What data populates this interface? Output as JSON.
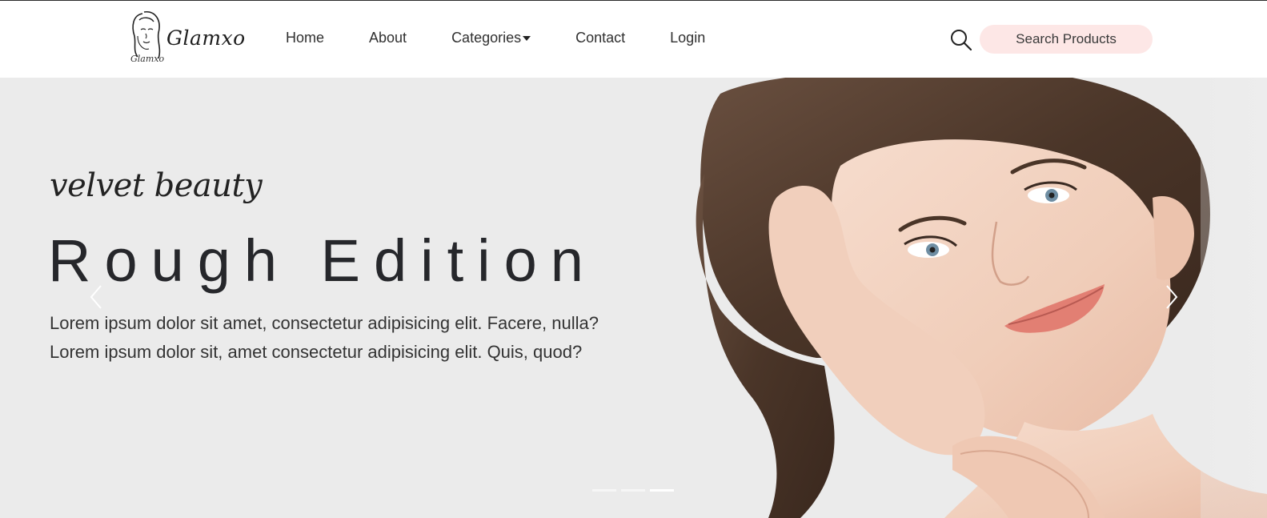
{
  "brand": {
    "name": "Glamxo",
    "sub_mark": "Glamxo"
  },
  "nav": {
    "items": [
      {
        "label": "Home"
      },
      {
        "label": "About"
      },
      {
        "label": "Categories"
      },
      {
        "label": "Contact"
      },
      {
        "label": "Login"
      }
    ]
  },
  "search": {
    "icon": "search-icon",
    "button_label": "Search Products"
  },
  "hero": {
    "kicker": "velvet beauty",
    "title": "Rough Edition",
    "description_lines": [
      "Lorem ipsum dolor sit amet, consectetur adipisicing elit. Facere, nulla?",
      "Lorem ipsum dolor sit, amet consectetur adipisicing elit. Quis, quod?"
    ],
    "indicators_count": 3,
    "active_indicator": 3
  },
  "colors": {
    "search_pill": "#fde7e6",
    "hero_bg": "#ebebeb",
    "text_dark": "#26272b"
  }
}
